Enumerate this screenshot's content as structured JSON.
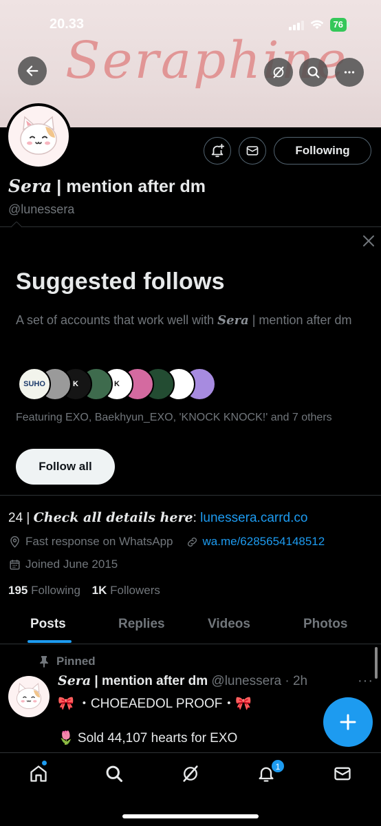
{
  "status_bar": {
    "time": "20.33",
    "battery": "76"
  },
  "banner": {
    "text": "Seraphine"
  },
  "profile": {
    "display_name_serif": "Sera",
    "display_name_rest": " | mention after dm",
    "handle": "@lunessera",
    "following_button": "Following"
  },
  "suggested": {
    "title": "Suggested follows",
    "desc_prefix": "A set of accounts that work well with ",
    "desc_serif": "Sera",
    "desc_suffix": " | mention after dm",
    "featuring": "Featuring EXO, Baekhyun_EXO, 'KNOCK KNOCK!' and 7 others",
    "follow_all": "Follow all",
    "avatars": [
      {
        "label": "SUHO",
        "bg": "#f2f4ec",
        "fg": "#1c3b6b"
      },
      {
        "label": "",
        "bg": "#9a9a9a",
        "fg": "#fff"
      },
      {
        "label": "K",
        "bg": "#151515",
        "fg": "#fff"
      },
      {
        "label": "",
        "bg": "#3e6b4d",
        "fg": "#e58cb3"
      },
      {
        "label": "K",
        "bg": "#ffffff",
        "fg": "#111"
      },
      {
        "label": "",
        "bg": "#d46aa0",
        "fg": "#fff"
      },
      {
        "label": "",
        "bg": "#234c32",
        "fg": "#c6e3c9"
      },
      {
        "label": "",
        "bg": "#ffffff",
        "fg": "#333"
      },
      {
        "label": "",
        "bg": "#a78be0",
        "fg": "#fff"
      }
    ]
  },
  "bio": {
    "prefix": "24 | ",
    "serif": "Check all details here",
    "colon": ": ",
    "link": "lunessera.carrd.co",
    "location": "Fast response on WhatsApp",
    "website": "wa.me/6285654148512",
    "joined": "Joined June 2015",
    "following_count": "195",
    "following_label": " Following",
    "followers_count": "1K",
    "followers_label": " Followers"
  },
  "tabs": [
    "Posts",
    "Replies",
    "Videos",
    "Photos"
  ],
  "post": {
    "pinned_label": "Pinned",
    "name_serif": "Sera",
    "name_rest": " | mention after dm",
    "meta": " @lunessera · 2h",
    "line1": "🎀 ・CHOEAEDOL PROOF・🎀",
    "line2": "🌷 Sold 44,107 hearts for EXO"
  },
  "nav": {
    "notifications_badge": "1"
  },
  "colors": {
    "accent": "#1d9bf0",
    "background": "#000000",
    "muted": "#71767b"
  }
}
